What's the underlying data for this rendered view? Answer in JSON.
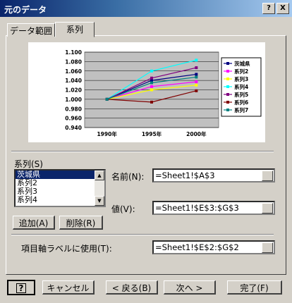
{
  "window": {
    "title": "元のデータ",
    "help": "?",
    "close": "X"
  },
  "tabs": [
    {
      "label": "データ範囲"
    },
    {
      "label": "系列"
    }
  ],
  "colors": {
    "titlebar": "#0a246a",
    "plot_bg": "#c0c0c0",
    "selection": "#0a246a"
  },
  "chart_data": {
    "type": "line",
    "categories": [
      "1990年",
      "1995年",
      "2000年"
    ],
    "yticks": [
      "1.100",
      "1.080",
      "1.060",
      "1.040",
      "1.020",
      "1.000",
      "0.980",
      "0.960",
      "0.940"
    ],
    "ylim": [
      0.94,
      1.1
    ],
    "grid": true,
    "legend": "right",
    "series": [
      {
        "name": "茨城県",
        "color": "#000080",
        "marker": "diamond",
        "values": [
          1.0,
          1.04,
          1.053
        ]
      },
      {
        "name": "系列2",
        "color": "#ff00ff",
        "marker": "square",
        "values": [
          1.0,
          1.027,
          1.037
        ]
      },
      {
        "name": "系列3",
        "color": "#ffff00",
        "marker": "triangle",
        "values": [
          1.0,
          1.02,
          1.03
        ]
      },
      {
        "name": "系列4",
        "color": "#00ffff",
        "marker": "x",
        "values": [
          1.0,
          1.06,
          1.083
        ]
      },
      {
        "name": "系列5",
        "color": "#800080",
        "marker": "star",
        "values": [
          1.0,
          1.045,
          1.067
        ]
      },
      {
        "name": "系列6",
        "color": "#800000",
        "marker": "circle",
        "values": [
          1.0,
          0.994,
          1.018
        ]
      },
      {
        "name": "系列7",
        "color": "#008080",
        "marker": "plus",
        "values": [
          1.0,
          1.035,
          1.047
        ]
      }
    ]
  },
  "series_section": {
    "label": "系列(S)",
    "items": [
      "茨城県",
      "系列2",
      "系列3",
      "系列4"
    ],
    "selected_index": 0,
    "add_button": "追加(A)",
    "delete_button": "削除(R)"
  },
  "fields": {
    "name_label": "名前(N):",
    "name_value": "=Sheet1!$A$3",
    "values_label": "値(V):",
    "values_value": "=Sheet1!$E$3:$G$3",
    "category_label": "項目軸ラベルに使用(T):",
    "category_value": "=Sheet1!$E$2:$G$2"
  },
  "footer": {
    "help_icon": "?",
    "cancel": "キャンセル",
    "back": "< 戻る(B)",
    "next": "次へ >",
    "finish": "完了(F)"
  }
}
